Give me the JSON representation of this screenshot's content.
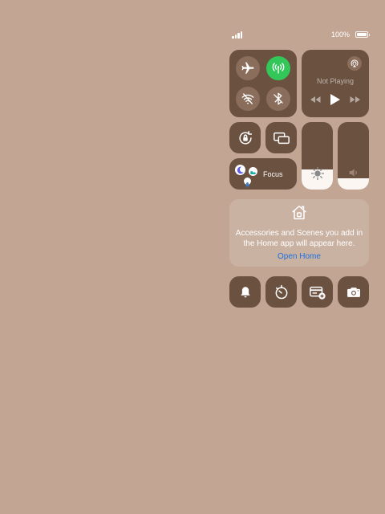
{
  "colors": {
    "background": "#c2a593",
    "tile": "#6b5140",
    "tile_button": "#8b6d5c",
    "cellular_active": "#33c759",
    "link": "#1e6fe0"
  },
  "status_bar": {
    "battery_text": "100%",
    "signal_icon": "cellular-signal-icon",
    "battery_icon": "battery-full-icon"
  },
  "connectivity": {
    "airplane_mode": {
      "icon": "airplane-icon",
      "active": false
    },
    "cellular_data": {
      "icon": "cellular-antenna-icon",
      "active": true
    },
    "wifi": {
      "icon": "wifi-off-icon",
      "active": false
    },
    "bluetooth": {
      "icon": "bluetooth-off-icon",
      "active": false
    }
  },
  "now_playing": {
    "title": "Not Playing",
    "airplay_icon": "airplay-icon",
    "controls": [
      "rewind-icon",
      "play-icon",
      "fast-forward-icon"
    ]
  },
  "quick_toggles": {
    "orientation_lock_icon": "rotation-lock-icon",
    "screen_mirroring_icon": "screen-mirroring-icon"
  },
  "focus": {
    "label": "Focus",
    "icons": [
      "moon-icon",
      "bed-icon",
      "person-icon"
    ]
  },
  "sliders": {
    "brightness": {
      "icon": "sun-icon",
      "level_percent": 30
    },
    "volume": {
      "icon": "speaker-icon",
      "level_percent": 17
    }
  },
  "home": {
    "icon": "home-icon",
    "message": "Accessories and Scenes you add in the Home app will appear here.",
    "link_label": "Open Home"
  },
  "bottom_row": [
    "bell-icon",
    "timer-icon",
    "wallet-add-icon",
    "camera-icon"
  ]
}
